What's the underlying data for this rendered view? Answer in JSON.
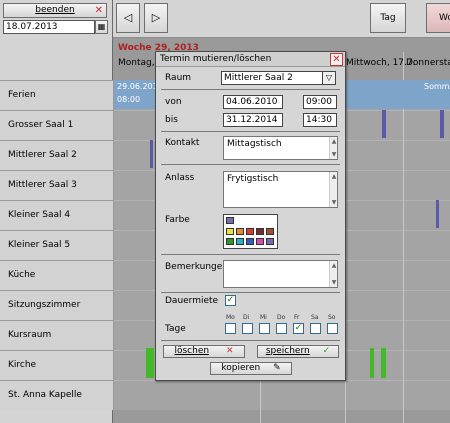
{
  "left_panel": {
    "end_label": "beenden",
    "date_value": "18.07.2013",
    "rooms": [
      "Ferien",
      "Grosser Saal 1",
      "Mittlerer Saal 2",
      "Mittlerer Saal 3",
      "Kleiner Saal 4",
      "Kleiner Saal 5",
      "Küche",
      "Sitzungszimmer",
      "Kursraum",
      "Kirche",
      "St. Anna Kapelle"
    ]
  },
  "toolbar": {
    "prev_icon": "◁",
    "next_icon": "▷",
    "day_label": "Tag",
    "week_label": "Wo"
  },
  "calendar": {
    "week_title": "Woche 29, 2013",
    "day_headers": [
      "Montag,",
      "Mittwoch, 17.7.",
      "Donnerstag"
    ],
    "ferien_date": "29.06.2013",
    "ferien_time": "08:00",
    "ferien_right": "Sommer"
  },
  "dialog": {
    "title": "Termin mutieren/löschen",
    "raum_label": "Raum",
    "raum_value": "Mittlerer Saal 2",
    "von_label": "von",
    "von_date": "04.06.2010",
    "von_time": "09:00",
    "bis_label": "bis",
    "bis_date": "31.12.2014",
    "bis_time": "14:30",
    "kontakt_label": "Kontakt",
    "kontakt_value": "Mittagstisch",
    "anlass_label": "Anlass",
    "anlass_value": "Frytigstisch",
    "farbe_label": "Farbe",
    "bemerkungen_label": "Bemerkungen",
    "bemerkungen_value": "",
    "dauermiete_label": "Dauermiete",
    "dauermiete_checked": true,
    "tage_label": "Tage",
    "days": [
      "Mo",
      "Di",
      "Mi",
      "Do",
      "Fr",
      "Sa",
      "So"
    ],
    "days_checked": [
      false,
      false,
      false,
      false,
      true,
      false,
      false
    ],
    "delete_label": "löschen",
    "save_label": "speichern",
    "copy_label": "kopieren",
    "selected_color": "#7a6ab0",
    "palette": [
      "#f0e23a",
      "#e88a2a",
      "#d83a3a",
      "#7a2a2a",
      "#a05030",
      "#2a9a2a",
      "#2ab0c8",
      "#3a5ac8",
      "#d84ab0",
      "#7a6ab0"
    ]
  },
  "colors": {
    "ferien_bar": "#7ea5c9",
    "event_green": "#44b828",
    "event_blue": "#5a5aa8",
    "week_title": "#b02020"
  }
}
